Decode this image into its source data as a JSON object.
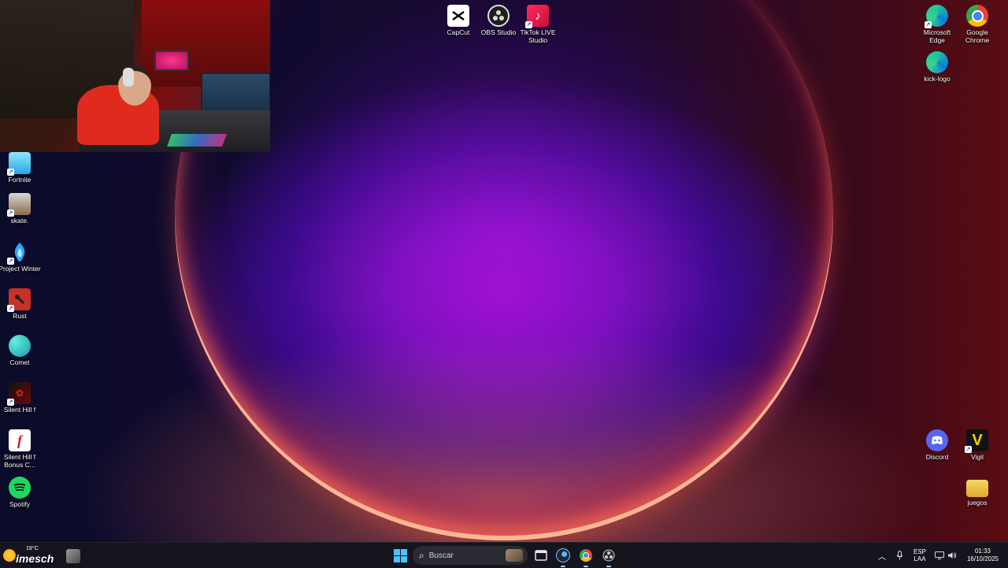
{
  "desktop": {
    "top_icons": [
      {
        "label": "CapCut",
        "icon": "capcut-icon"
      },
      {
        "label": "OBS Studio",
        "icon": "obs-icon"
      },
      {
        "label": "TikTok LIVE Studio",
        "icon": "tiktok-live-icon"
      }
    ],
    "right_icons": [
      {
        "label": "Microsoft Edge",
        "icon": "edge-icon"
      },
      {
        "label": "Google Chrome",
        "icon": "chrome-icon"
      },
      {
        "label": "kick-logo",
        "icon": "edge-icon"
      },
      {
        "label": "Discord",
        "icon": "discord-icon"
      },
      {
        "label": "Vigil",
        "icon": "vigil-icon"
      },
      {
        "label": "juegos",
        "icon": "folder-icon"
      }
    ],
    "left_icons": [
      {
        "label": "Fortnite",
        "icon": "fortnite-icon"
      },
      {
        "label": "skate.",
        "icon": "skate-icon"
      },
      {
        "label": "Project Winter",
        "icon": "project-winter-icon"
      },
      {
        "label": "Rust",
        "icon": "rust-icon"
      },
      {
        "label": "Comet",
        "icon": "comet-icon"
      },
      {
        "label": "Silent Hill f",
        "icon": "silent-hill-icon"
      },
      {
        "label": "Silent Hill f Bonus C...",
        "icon": "silent-hill-bonus-icon"
      },
      {
        "label": "Spotify",
        "icon": "spotify-icon"
      }
    ]
  },
  "taskbar": {
    "weather_temp": "19°C",
    "weather_overlay": "imesch",
    "search_placeholder": "Buscar",
    "apps": [
      "file-explorer-icon",
      "steam-icon",
      "chrome-icon",
      "obs-icon"
    ],
    "tray": {
      "lang_line1": "ESP",
      "lang_line2": "LAA",
      "time": "01:33",
      "date": "16/10/2025"
    }
  },
  "colors": {
    "accent": "#4cc2ff",
    "taskbar_bg": "#16161e"
  }
}
